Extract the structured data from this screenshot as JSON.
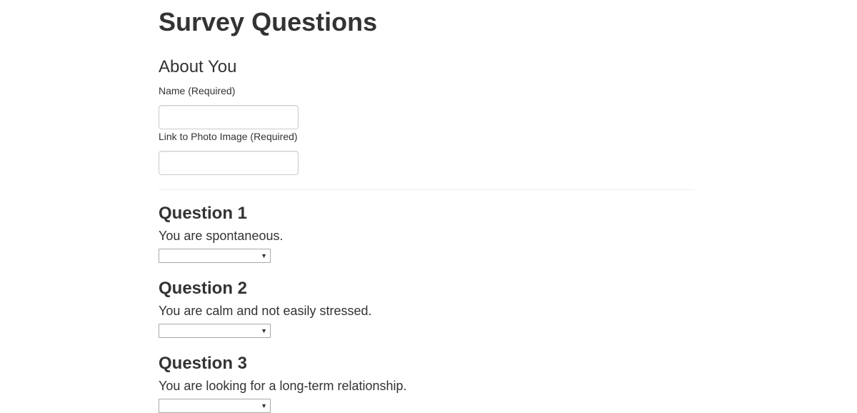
{
  "page": {
    "title": "Survey Questions"
  },
  "about_you": {
    "heading": "About You",
    "name_label": "Name (Required)",
    "name_value": "",
    "photo_label": "Link to Photo Image (Required)",
    "photo_value": ""
  },
  "questions": [
    {
      "heading": "Question 1",
      "text": "You are spontaneous.",
      "selected": ""
    },
    {
      "heading": "Question 2",
      "text": "You are calm and not easily stressed.",
      "selected": ""
    },
    {
      "heading": "Question 3",
      "text": "You are looking for a long-term relationship.",
      "selected": ""
    }
  ],
  "icons": {
    "dropdown": "chevron-down-icon"
  },
  "colors": {
    "text": "#333333",
    "input_border": "#cccccc",
    "divider": "#eeeeee"
  }
}
